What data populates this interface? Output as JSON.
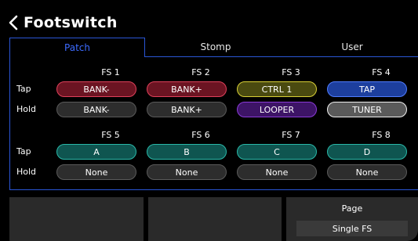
{
  "header": {
    "title": "Footswitch",
    "back_icon": "chevron-left-icon"
  },
  "tabs": [
    {
      "label": "Patch",
      "active": true
    },
    {
      "label": "Stomp",
      "active": false
    },
    {
      "label": "User",
      "active": false
    }
  ],
  "rows": {
    "tap_label": "Tap",
    "hold_label": "Hold"
  },
  "footswitches": [
    {
      "name": "FS 1",
      "tap": "BANK-",
      "tap_color": "red",
      "hold": "BANK-",
      "hold_color": "gray"
    },
    {
      "name": "FS 2",
      "tap": "BANK+",
      "tap_color": "red",
      "hold": "BANK+",
      "hold_color": "gray"
    },
    {
      "name": "FS 3",
      "tap": "CTRL 1",
      "tap_color": "yellow",
      "hold": "LOOPER",
      "hold_color": "purple"
    },
    {
      "name": "FS 4",
      "tap": "TAP",
      "tap_color": "blue",
      "hold": "TUNER",
      "hold_color": "white"
    },
    {
      "name": "FS 5",
      "tap": "A",
      "tap_color": "teal",
      "hold": "None",
      "hold_color": "gray"
    },
    {
      "name": "FS 6",
      "tap": "B",
      "tap_color": "teal",
      "hold": "None",
      "hold_color": "gray"
    },
    {
      "name": "FS 7",
      "tap": "C",
      "tap_color": "teal",
      "hold": "None",
      "hold_color": "gray"
    },
    {
      "name": "FS 8",
      "tap": "D",
      "tap_color": "teal",
      "hold": "None",
      "hold_color": "gray"
    }
  ],
  "colors": {
    "accent": "#2a56d6",
    "red": {
      "bg": "#6b1422",
      "border": "#e0405a"
    },
    "yellow": {
      "bg": "#4a4a10",
      "border": "#d8cf35"
    },
    "purple": {
      "bg": "#3d1466",
      "border": "#8a3ad8"
    },
    "blue": {
      "bg": "#1d3f9e",
      "border": "#4f7cff"
    },
    "white": {
      "bg": "#5a5a5a",
      "border": "#f0f0f0"
    },
    "teal": {
      "bg": "#0f5550",
      "border": "#2ab8a8"
    },
    "gray": {
      "bg": "#2d2d2d",
      "border": "#5a5a5a"
    }
  },
  "bottom": {
    "page_label": "Page",
    "page_value": "Single FS"
  }
}
